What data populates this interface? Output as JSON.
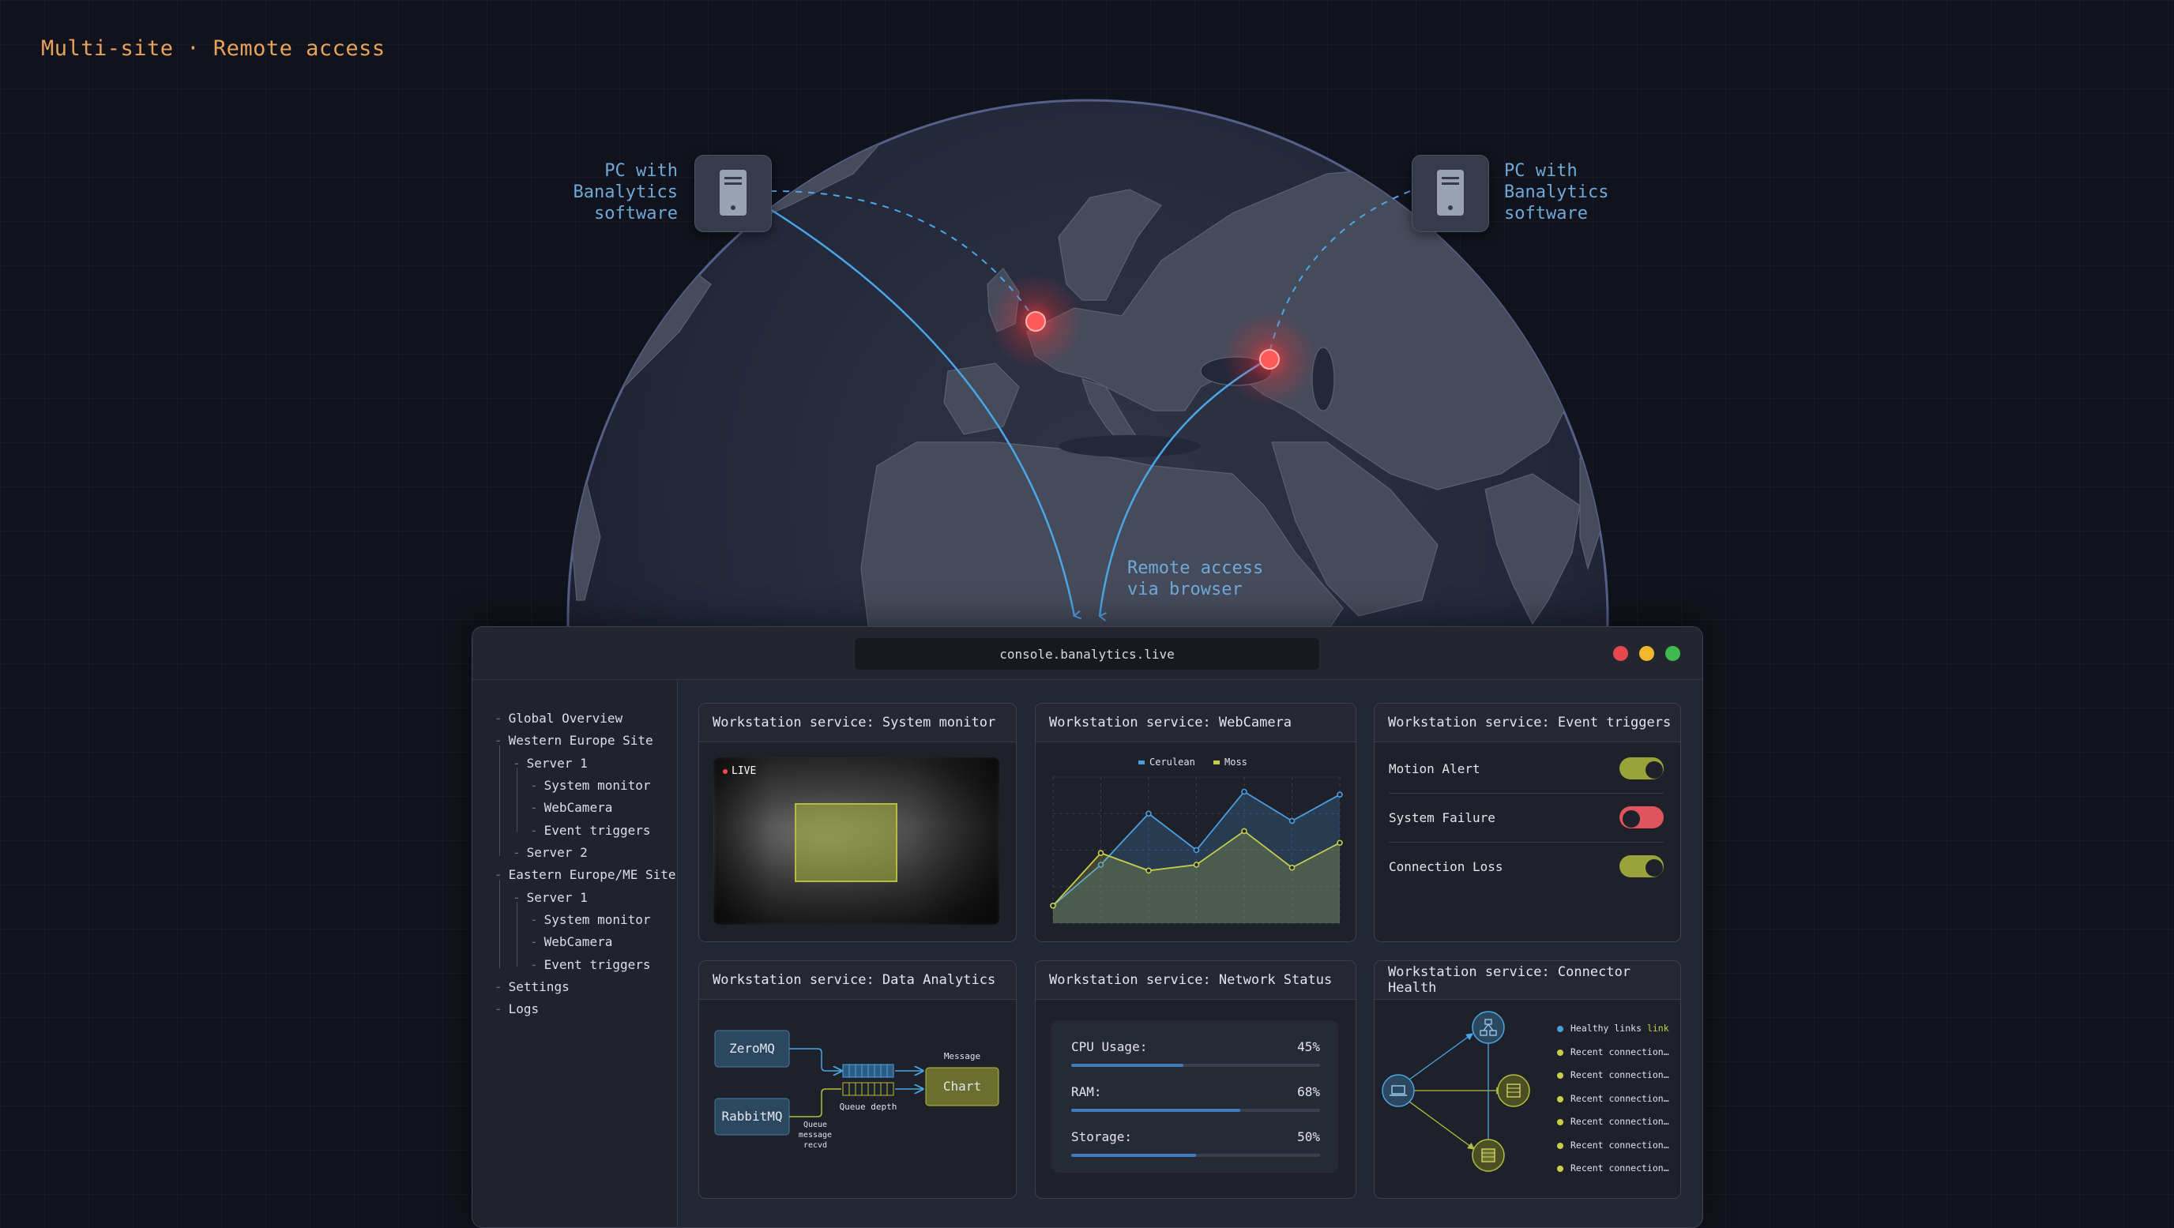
{
  "header": {
    "title": "Multi-site · Remote access"
  },
  "map": {
    "pc_left_label": "PC with\nBanalytics\nsoftware",
    "pc_right_label": "PC with\nBanalytics\nsoftware",
    "remote_label": "Remote access\nvia browser"
  },
  "browser": {
    "url": "console.banalytics.live",
    "controls": {
      "close_color": "#e5484d",
      "minimize_color": "#f1b82d",
      "maximize_color": "#3fba50"
    }
  },
  "sidebar": {
    "items": [
      {
        "label": "Global Overview"
      },
      {
        "label": "Western Europe Site"
      },
      {
        "label": "Server 1"
      },
      {
        "label": "System monitor"
      },
      {
        "label": "WebCamera"
      },
      {
        "label": "Event triggers"
      },
      {
        "label": "Server 2"
      },
      {
        "label": "Eastern Europe/ME Site"
      },
      {
        "label": "Server 1"
      },
      {
        "label": "System monitor"
      },
      {
        "label": "WebCamera"
      },
      {
        "label": "Event triggers"
      },
      {
        "label": "Settings"
      },
      {
        "label": "Logs"
      }
    ]
  },
  "cards": {
    "system_monitor": {
      "title": "Workstation service: System monitor",
      "live_badge": "LIVE"
    },
    "webcamera": {
      "title": "Workstation service: WebCamera",
      "legend": [
        "Cerulean",
        "Moss"
      ],
      "series_colors": {
        "Cerulean": "#4a9ee0",
        "Moss": "#c8cd4a"
      }
    },
    "event_triggers": {
      "title": "Workstation service: Event triggers",
      "toggles": [
        {
          "label": "Motion Alert",
          "state": "on",
          "color": "#9aa23a"
        },
        {
          "label": "System Failure",
          "state": "off",
          "color": "#e0545e"
        },
        {
          "label": "Connection Loss",
          "state": "on",
          "color": "#9aa23a"
        }
      ]
    },
    "data_analytics": {
      "title": "Workstation service: Data Analytics",
      "sources": [
        "ZeroMQ",
        "RabbitMQ"
      ],
      "sink": "Chart",
      "message_label": "Message",
      "queue_depth_label": "Queue depth",
      "queue_recv_label": "Queue\nmessage\nrecvd"
    },
    "network_status": {
      "title": "Workstation service: Network Status",
      "metrics": [
        {
          "label": "CPU Usage:",
          "value": "45%",
          "fraction": 0.45
        },
        {
          "label": "RAM:",
          "value": "68%",
          "fraction": 0.68
        },
        {
          "label": "Storage:",
          "value": "50%",
          "fraction": 0.5
        }
      ]
    },
    "connector_health": {
      "title": "Workstation service: Connector Health",
      "legend": [
        {
          "label": "Healthy links",
          "suffix": "link",
          "color": "#4a9ee0"
        },
        {
          "label": "Recent connection…",
          "color": "#c8cd4a"
        },
        {
          "label": "Recent connection…",
          "color": "#c8cd4a"
        },
        {
          "label": "Recent connection…",
          "color": "#c8cd4a"
        },
        {
          "label": "Recent connection…",
          "color": "#c8cd4a"
        },
        {
          "label": "Recent connection…",
          "color": "#c8cd4a"
        },
        {
          "label": "Recent connection…",
          "color": "#c8cd4a"
        }
      ]
    }
  },
  "chart_data": {
    "type": "area",
    "title": "",
    "xlabel": "",
    "ylabel": "",
    "x": [
      1,
      2,
      3,
      4,
      5,
      6,
      7
    ],
    "series": [
      {
        "name": "Cerulean",
        "values": [
          12,
          40,
          75,
          50,
          90,
          70,
          88
        ]
      },
      {
        "name": "Moss",
        "values": [
          12,
          48,
          36,
          40,
          63,
          38,
          55
        ]
      }
    ],
    "ylim": [
      0,
      100
    ],
    "grid": true,
    "legend": "top-center"
  }
}
